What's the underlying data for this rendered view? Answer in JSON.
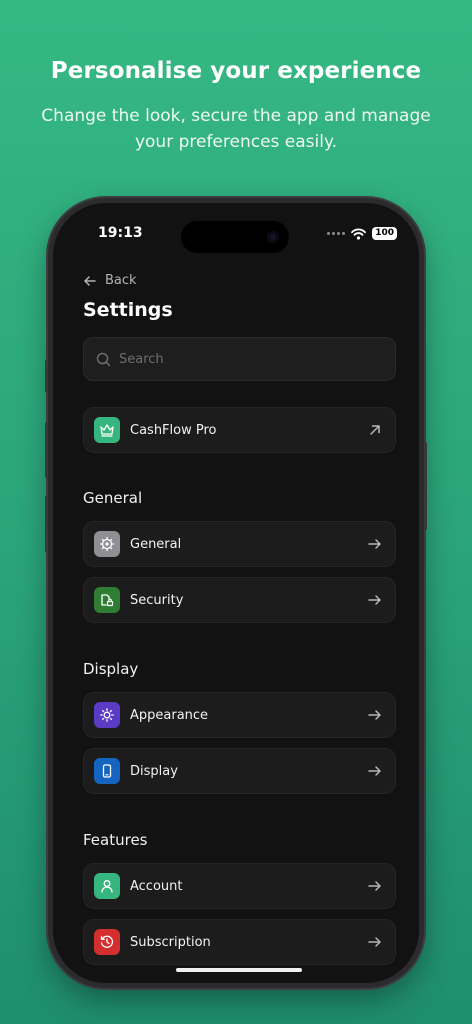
{
  "promo": {
    "headline": "Personalise your experience",
    "subline": "Change the look, secure the app and manage your preferences easily."
  },
  "status_bar": {
    "time": "19:13",
    "battery": "100"
  },
  "nav": {
    "back_label": "Back",
    "title": "Settings"
  },
  "search": {
    "placeholder": "Search"
  },
  "pro": {
    "label": "CashFlow Pro",
    "icon": "crown-icon",
    "color": "#37b57e"
  },
  "sections": {
    "general": "General",
    "display": "Display",
    "features": "Features"
  },
  "items": {
    "general": {
      "label": "General",
      "icon": "gear-icon",
      "color": "#8e8e93"
    },
    "security": {
      "label": "Security",
      "icon": "lock-document-icon",
      "color": "#2e7d32"
    },
    "appearance": {
      "label": "Appearance",
      "icon": "sun-icon",
      "color": "#5b3bc4"
    },
    "display": {
      "label": "Display",
      "icon": "phone-icon",
      "color": "#1565c0"
    },
    "account": {
      "label": "Account",
      "icon": "person-icon",
      "color": "#37b57e"
    },
    "subscription": {
      "label": "Subscription",
      "icon": "history-icon",
      "color": "#d32f2f"
    }
  }
}
